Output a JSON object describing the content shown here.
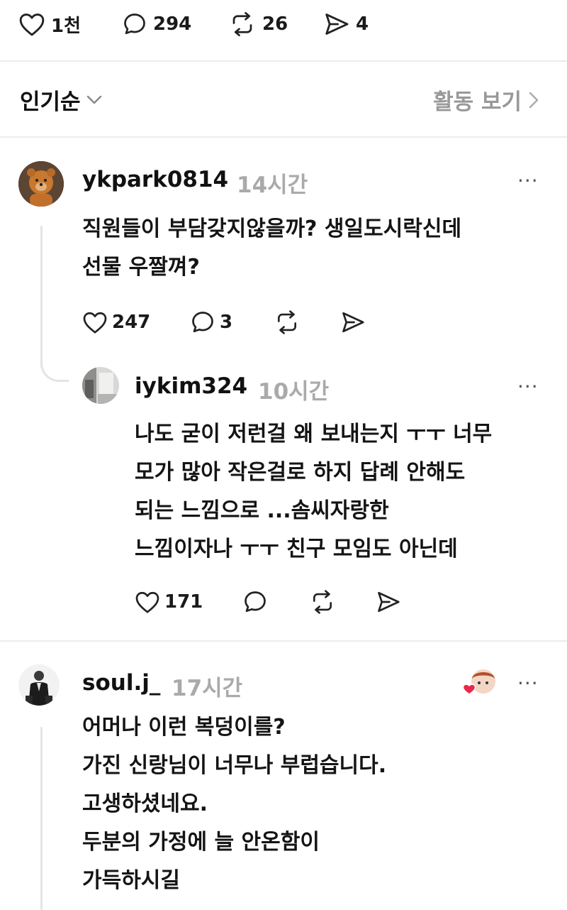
{
  "stats": {
    "likes": "1천",
    "comments": "294",
    "reposts": "26",
    "shares": "4"
  },
  "sort": {
    "label": "인기순",
    "activity_label": "활동 보기"
  },
  "comments": [
    {
      "username": "ykpark0814",
      "time": "14시간",
      "lines": [
        "직원들이 부담갖지않을까? 생일도시락신데",
        "선물 우짤껴?"
      ],
      "likes": "247",
      "replies": "3"
    },
    {
      "username": "iykim324",
      "time": "10시간",
      "lines": [
        "나도 굳이 저런걸 왜 보내는지 ㅜㅜ 너무",
        "모가 많아 작은걸로 하지 답례 안해도",
        "되는 느낌으로 ...솜씨자랑한",
        "느낌이자나 ㅜㅜ 친구 모임도 아닌데"
      ],
      "likes": "171"
    },
    {
      "username": "soul.j_",
      "time": "17시간",
      "lines": [
        "어머나 이런 복덩이를?",
        "가진 신랑님이 너무나 부럽습니다.",
        "고생하셨네요.",
        "두분의 가정에 늘 안온함이",
        "가득하시길"
      ]
    }
  ],
  "more_label": "···",
  "colors": {
    "text": "#101010",
    "muted": "#aaaaaa",
    "divider": "#ececec",
    "like_heart": "#e8294a"
  },
  "icons": [
    "heart-icon",
    "comment-icon",
    "repost-icon",
    "share-icon",
    "chevron-down-icon",
    "chevron-right-icon",
    "more-icon",
    "avatar"
  ]
}
